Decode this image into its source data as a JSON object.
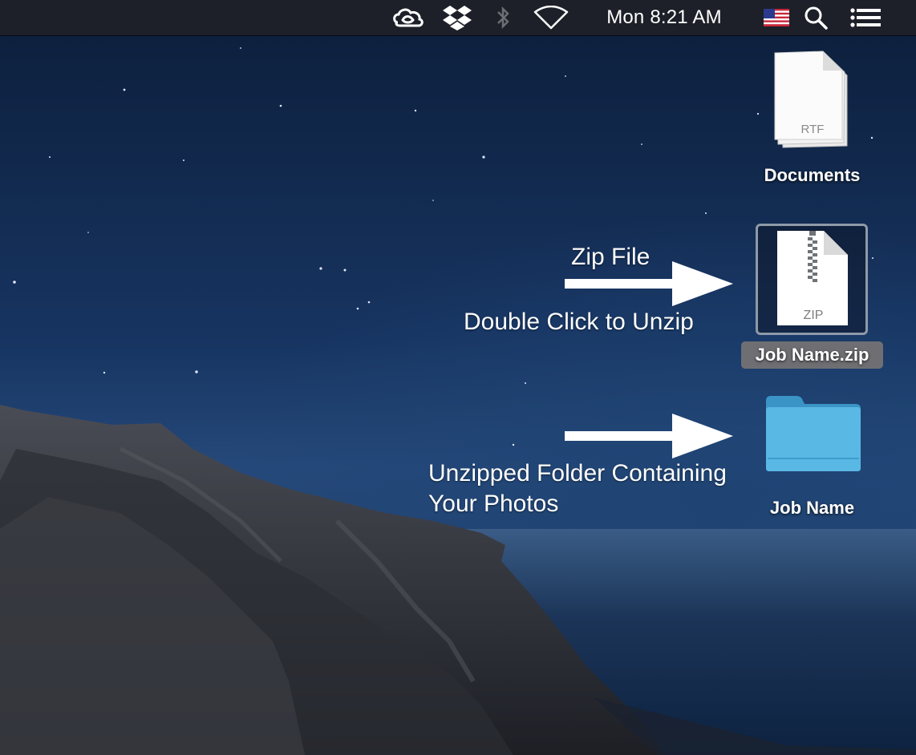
{
  "menubar": {
    "status_icons": [
      "creative-cloud-icon",
      "dropbox-icon",
      "bluetooth-icon",
      "wifi-icon"
    ],
    "clock": "Mon 8:21 AM",
    "right_icons": [
      "us-flag-icon",
      "spotlight-search-icon",
      "notification-center-icon"
    ]
  },
  "desktop": {
    "items": [
      {
        "label": "Documents",
        "icon": "rtf-document-stack-icon",
        "badge": "RTF"
      },
      {
        "label": "Job Name.zip",
        "icon": "zip-file-icon",
        "badge": "ZIP",
        "selected": true
      },
      {
        "label": "Job Name",
        "icon": "folder-icon"
      }
    ]
  },
  "annotations": {
    "zip_title": "Zip File",
    "zip_instruction": "Double Click to Unzip",
    "folder_line1": "Unzipped Folder Containing",
    "folder_line2": "Your Photos"
  },
  "colors": {
    "menubar_bg": "#1d2028",
    "folder_blue": "#4fb0dc",
    "selection_border": "#8e9aa8",
    "label_highlight": "#6f6f73"
  }
}
